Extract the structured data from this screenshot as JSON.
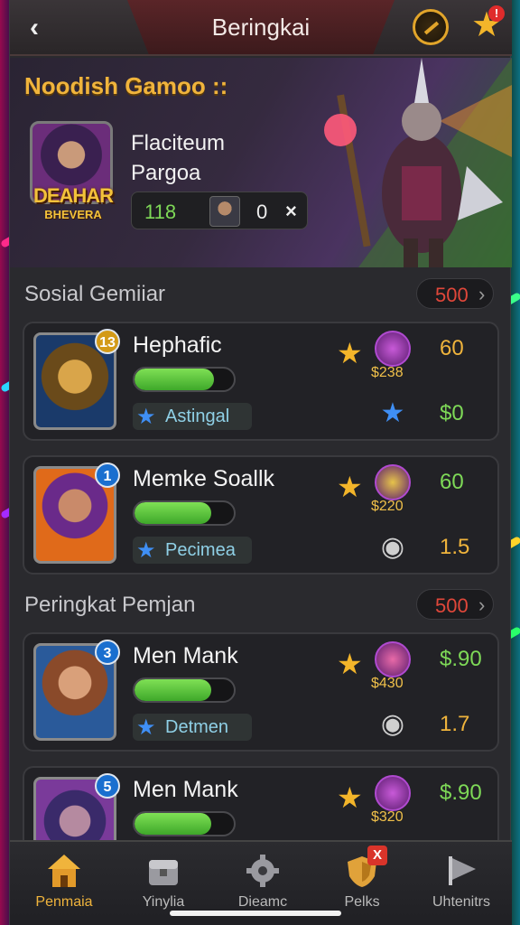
{
  "header": {
    "title": "Beringkai",
    "back_icon": "chevron-left-icon",
    "settings_icon": "compass-icon",
    "favorites_icon": "star-icon",
    "notification_badge": "!"
  },
  "hero": {
    "title": "Noodish Gamoo ::",
    "badge_line1": "DEAHAR",
    "badge_line2": "BHEVERA",
    "name_line1": "Flaciteum",
    "name_line2": "Pargoa",
    "stat_value": "118",
    "stat_count": "0",
    "stat_close": "×"
  },
  "sections": [
    {
      "title": "Sosial Gemiiar",
      "pill_value": "500",
      "pill_icon": "›",
      "cards": [
        {
          "rank": "13",
          "rank_style": "gold",
          "name": "Hephafic",
          "progress": 0.8,
          "tag": "Astingal",
          "tag_icon": "★",
          "medal_value": "$238",
          "value1": "60",
          "value1_color": "#f0b43c",
          "icon2": "★",
          "icon2_color": "#3f8ff5",
          "value2": "$0",
          "value2_color": "#7ed957"
        },
        {
          "rank": "1",
          "rank_style": "blue",
          "name": "Memke Soallk",
          "progress": 0.77,
          "tag": "Pecimea",
          "tag_icon": "★",
          "medal_value": "$220",
          "value1": "60",
          "value1_color": "#7ed957",
          "icon2": "◉",
          "icon2_color": "#cfcfcf",
          "value2": "1.5",
          "value2_color": "#f0b43c"
        }
      ]
    },
    {
      "title": "Peringkat Pemjan",
      "pill_value": "500",
      "pill_icon": "›",
      "cards": [
        {
          "rank": "3",
          "rank_style": "blue",
          "name": "Men Mank",
          "progress": 0.77,
          "tag": "Detmen",
          "tag_icon": "★",
          "medal_value": "$430",
          "value1": "$.90",
          "value1_color": "#7ed957",
          "icon2": "◉",
          "icon2_color": "#cfcfcf",
          "value2": "1.7",
          "value2_color": "#f0b43c"
        },
        {
          "rank": "5",
          "rank_style": "blue",
          "name": "Men Mank",
          "progress": 0.77,
          "tag": "",
          "tag_icon": "",
          "medal_value": "$320",
          "value1": "$.90",
          "value1_color": "#7ed957",
          "icon2": "",
          "icon2_color": "#cfcfcf",
          "value2": "",
          "value2_color": "#f0b43c"
        }
      ]
    }
  ],
  "nav": [
    {
      "label": "Penmaia",
      "icon": "home-icon",
      "active": true
    },
    {
      "label": "Yinylia",
      "icon": "chest-icon",
      "active": false
    },
    {
      "label": "Dieamc",
      "icon": "gear-icon",
      "active": false
    },
    {
      "label": "Pelks",
      "icon": "shield-icon",
      "active": false,
      "badge": "X"
    },
    {
      "label": "Uhtenitrs",
      "icon": "arrow-flag-icon",
      "active": false
    }
  ]
}
